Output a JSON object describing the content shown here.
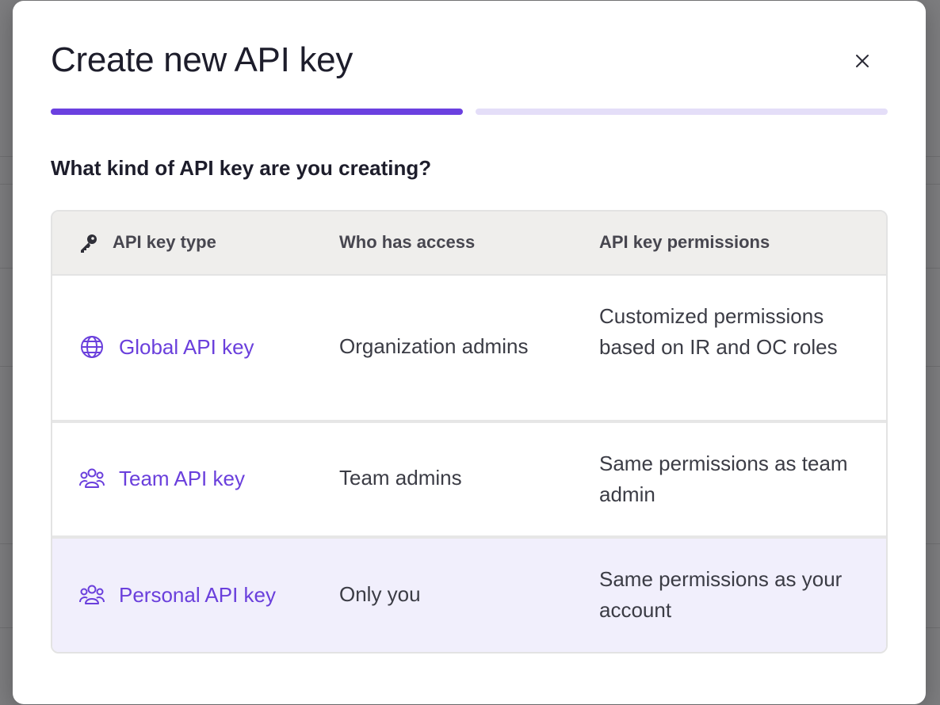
{
  "modal": {
    "title": "Create new API key",
    "close_label": "×",
    "steps": [
      {
        "state": "active",
        "color": "#6b40e0"
      },
      {
        "state": "upcoming",
        "color": "#e4def8"
      }
    ],
    "question": "What kind of API key are you creating?"
  },
  "table": {
    "headers": {
      "type": "API key type",
      "access": "Who has access",
      "permissions": "API key permissions",
      "type_icon": "key-icon"
    },
    "rows": [
      {
        "type": "Global API key",
        "icon": "globe-icon",
        "access": "Organization admins",
        "permissions": "Customized permissions based on IR and OC roles",
        "selected": false
      },
      {
        "type": "Team API key",
        "icon": "users-icon",
        "access": "Team admins",
        "permissions": "Same permissions as team admin",
        "selected": false
      },
      {
        "type": "Personal API key",
        "icon": "users-icon",
        "access": "Only you",
        "permissions": "Same permissions as your account",
        "selected": true
      }
    ]
  },
  "colors": {
    "accent": "#6b40e0",
    "link": "#6a3fdc",
    "selected_row": "#f1effc"
  }
}
